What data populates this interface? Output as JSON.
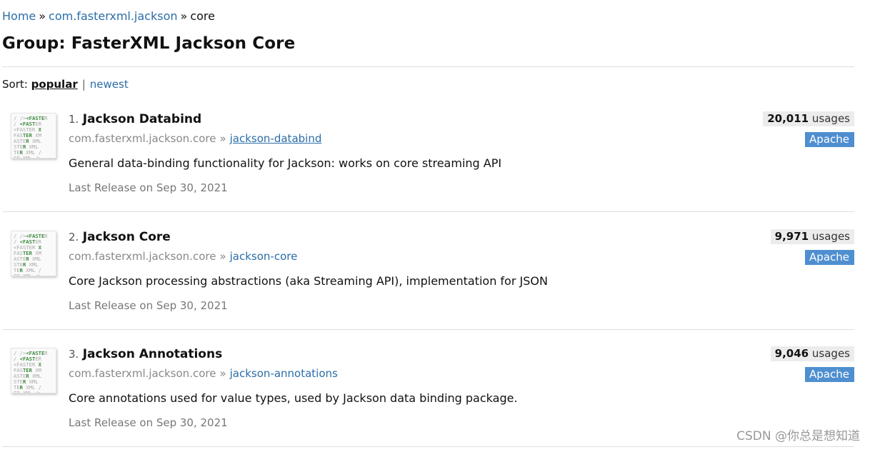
{
  "breadcrumb": {
    "home": "Home",
    "sep1": "»",
    "group": "com.fasterxml.jackson",
    "sep2": "»",
    "current": "core"
  },
  "page": {
    "title": "Group: FasterXML Jackson Core"
  },
  "sort": {
    "label": "Sort:",
    "popular": "popular",
    "separator": "|",
    "newest": "newest"
  },
  "logo": {
    "lines": [
      [
        "/ />",
        "<FASTE",
        "R"
      ],
      [
        "/ ",
        "<FAST",
        "ER"
      ],
      [
        "<FASTER",
        " X"
      ],
      [
        "FAS",
        "TER",
        " XM"
      ],
      [
        "ASTE",
        "R",
        " XML"
      ],
      [
        "STE",
        "R",
        " XML"
      ],
      [
        "TE",
        "R",
        " XML /"
      ],
      [
        "ER XML />"
      ]
    ],
    "icon": "fasterxml-logo"
  },
  "items": [
    {
      "number": "1.",
      "title": "Jackson Databind",
      "group": "com.fasterxml.jackson.core",
      "arrow": "»",
      "artifact": "jackson-databind",
      "description": "General data-binding functionality for Jackson: works on core streaming API",
      "release": "Last Release on Sep 30, 2021",
      "usages_count": "20,011",
      "usages_label": "usages",
      "license": "Apache"
    },
    {
      "number": "2.",
      "title": "Jackson Core",
      "group": "com.fasterxml.jackson.core",
      "arrow": "»",
      "artifact": "jackson-core",
      "description": "Core Jackson processing abstractions (aka Streaming API), implementation for JSON",
      "release": "Last Release on Sep 30, 2021",
      "usages_count": "9,971",
      "usages_label": "usages",
      "license": "Apache"
    },
    {
      "number": "3.",
      "title": "Jackson Annotations",
      "group": "com.fasterxml.jackson.core",
      "arrow": "»",
      "artifact": "jackson-annotations",
      "description": "Core annotations used for value types, used by Jackson data binding package.",
      "release": "Last Release on Sep 30, 2021",
      "usages_count": "9,046",
      "usages_label": "usages",
      "license": "Apache"
    }
  ],
  "watermark": "CSDN @你总是想知道",
  "colors": {
    "link": "#2a6da8",
    "license_badge": "#4f8fd0",
    "usages_bg": "#ececec",
    "divider": "#dedede"
  }
}
